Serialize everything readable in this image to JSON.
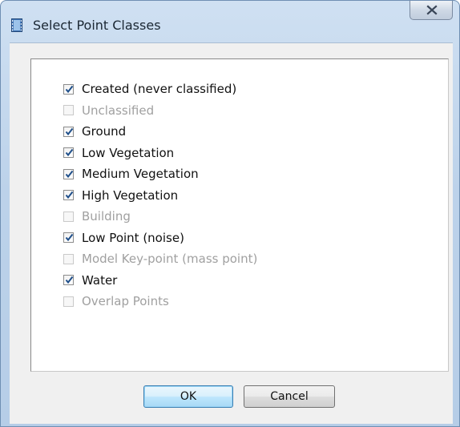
{
  "window": {
    "title": "Select Point Classes",
    "icon": "film-strip-icon",
    "close_icon": "close-x-icon"
  },
  "point_classes": [
    {
      "label": "Created (never classified)",
      "checked": true,
      "enabled": true
    },
    {
      "label": "Unclassified",
      "checked": false,
      "enabled": false
    },
    {
      "label": "Ground",
      "checked": true,
      "enabled": true
    },
    {
      "label": "Low Vegetation",
      "checked": true,
      "enabled": true
    },
    {
      "label": "Medium Vegetation",
      "checked": true,
      "enabled": true
    },
    {
      "label": "High Vegetation",
      "checked": true,
      "enabled": true
    },
    {
      "label": "Building",
      "checked": false,
      "enabled": false
    },
    {
      "label": "Low Point (noise)",
      "checked": true,
      "enabled": true
    },
    {
      "label": "Model Key-point (mass point)",
      "checked": false,
      "enabled": false
    },
    {
      "label": "Water",
      "checked": true,
      "enabled": true
    },
    {
      "label": "Overlap Points",
      "checked": false,
      "enabled": false
    }
  ],
  "buttons": {
    "ok_label": "OK",
    "cancel_label": "Cancel"
  },
  "colors": {
    "title_bar": "#bcd2ea",
    "check_mark": "#1f4f8a",
    "disabled_text": "#a0a0a0",
    "default_button_border": "#3c7fb1"
  }
}
